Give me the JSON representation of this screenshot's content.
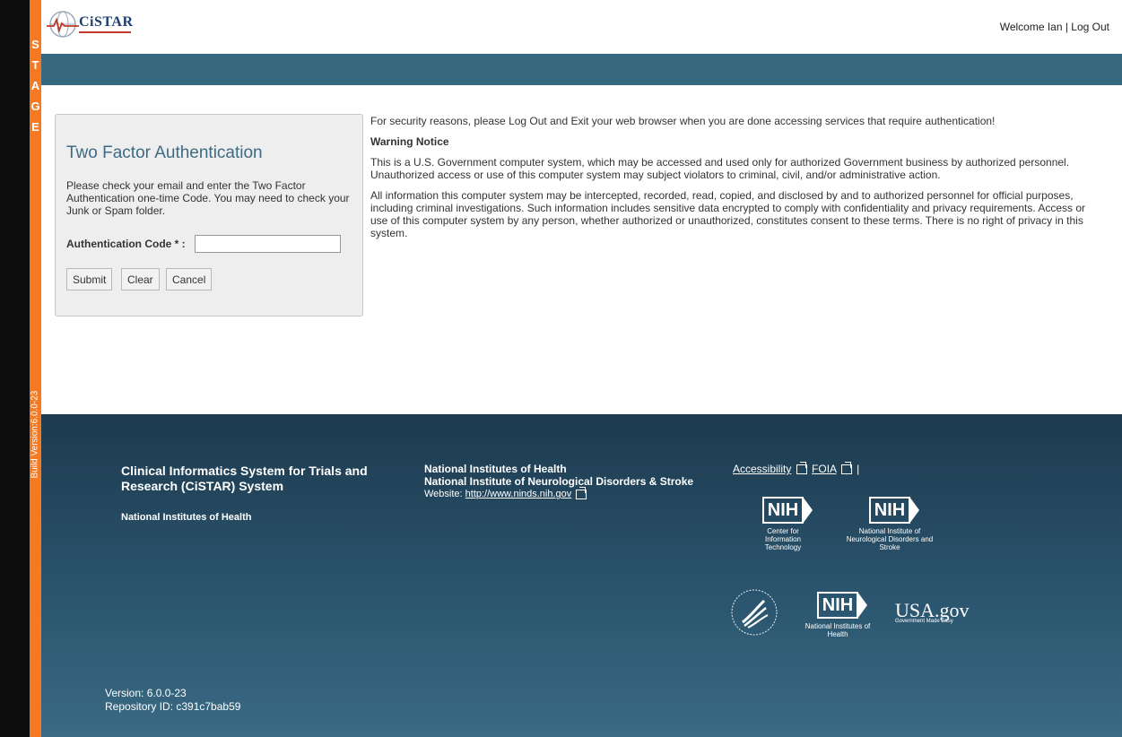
{
  "stage": {
    "letters": [
      "S",
      "T",
      "A",
      "G",
      "E"
    ],
    "build": "Build Version:6.0.0-23"
  },
  "header": {
    "logo_text": "CiSTAR",
    "welcome": "Welcome Ian | Log Out"
  },
  "login": {
    "title": "Two Factor Authentication",
    "description": "Please check your email and enter the Two Factor Authentication one-time Code. You may need to check your Junk or Spam folder.",
    "code_label": "Authentication Code * :",
    "code_value": "",
    "submit": "Submit",
    "clear": "Clear",
    "cancel": "Cancel"
  },
  "notice": {
    "security": "For security reasons, please Log Out and Exit your web browser when you are done accessing services that require authentication!",
    "heading": "Warning Notice",
    "para1": "This is a U.S. Government computer system, which may be accessed and used only for authorized Government business by authorized personnel. Unauthorized access or use of this computer system may subject violators to criminal, civil, and/or administrative action.",
    "para2": "All information this computer system may be intercepted, recorded, read, copied, and disclosed by and to authorized personnel for official purposes, including criminal investigations. Such information includes sensitive data encrypted to comply with confidentiality and privacy requirements. Access or use of this computer system by any person, whether authorized or unauthorized, constitutes consent to these terms. There is no right of privacy in this system."
  },
  "footer": {
    "system_name": "Clinical Informatics System for Trials and Research (CiSTAR) System",
    "org": "National Institutes of Health",
    "col2_line1": "National Institutes of Health",
    "col2_line2": "National Institute of Neurological Disorders & Stroke",
    "website_label": "Website:",
    "website_url": "http://www.ninds.nih.gov",
    "accessibility": "Accessibility",
    "foia": "FOIA",
    "separator": "|",
    "logos": {
      "nih_mark": "NIH",
      "cit_caption": "Center for Information Technology",
      "ninds_caption": "National Institute of Neurological Disorders and Stroke",
      "nih_caption": "National Institutes of Health",
      "usagov": "USA.gov",
      "usagov_small": "Government Made Easy"
    },
    "version": "Version: 6.0.0-23",
    "repository": "Repository ID: c391c7bab59"
  }
}
